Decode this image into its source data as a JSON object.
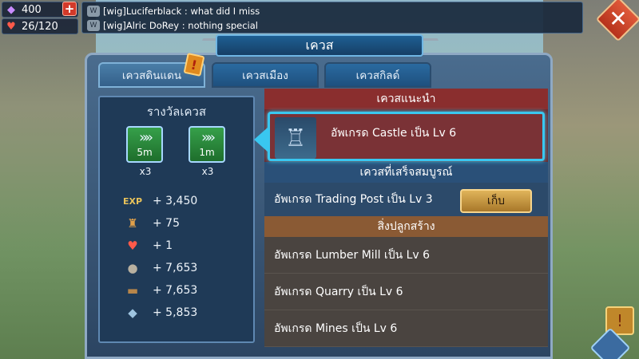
{
  "resources": {
    "gems": "400",
    "stamina": "26/120",
    "gem_icon": "gem-icon",
    "stamina_icon": "heart-icon",
    "add_icon": "plus-icon"
  },
  "chat": {
    "lines": [
      {
        "author": "[wig]Luciferblack",
        "message": "what did I miss"
      },
      {
        "author": "[wig]Alric DoRey",
        "message": "nothing special"
      }
    ]
  },
  "window": {
    "title": "เควส",
    "close_icon": "close-icon"
  },
  "tabs": [
    {
      "label": "เควสดินแดน",
      "active": true
    },
    {
      "label": "เควสเมือง",
      "active": false
    },
    {
      "label": "เควสกิลด์",
      "active": false
    }
  ],
  "rewards": {
    "title": "รางวัลเควส",
    "boosts": [
      {
        "time": "5m",
        "qty": "x3",
        "icon": "speedup-icon"
      },
      {
        "time": "1m",
        "qty": "x3",
        "icon": "speedup-icon"
      }
    ],
    "items": [
      {
        "icon": "exp-icon",
        "value": "+ 3,450"
      },
      {
        "icon": "hero-exp-icon",
        "value": "+ 75"
      },
      {
        "icon": "heart-icon",
        "value": "+ 1"
      },
      {
        "icon": "stone-icon",
        "value": "+ 7,653"
      },
      {
        "icon": "wood-icon",
        "value": "+ 7,653"
      },
      {
        "icon": "ore-icon",
        "value": "+ 5,853"
      }
    ]
  },
  "recommended": {
    "header": "เควสแนะนำ",
    "item": "อัพเกรด Castle เป็น Lv 6",
    "thumb_icon": "castle-icon"
  },
  "completed": {
    "header": "เควสที่เสร็จสมบูรณ์",
    "item": "อัพเกรด Trading Post เป็น Lv 3",
    "button": "เก็บ"
  },
  "construction": {
    "header": "สิ่งปลูกสร้าง",
    "items": [
      "อัพเกรด Lumber Mill เป็น Lv 6",
      "อัพเกรด Quarry เป็น Lv 6",
      "อัพเกรด Mines เป็น Lv 6"
    ]
  },
  "colors": {
    "recommended_header": "#8a2e2e",
    "completed_header": "#2a5078",
    "construction_header": "#8a5a34",
    "highlight": "#39c7f0"
  }
}
